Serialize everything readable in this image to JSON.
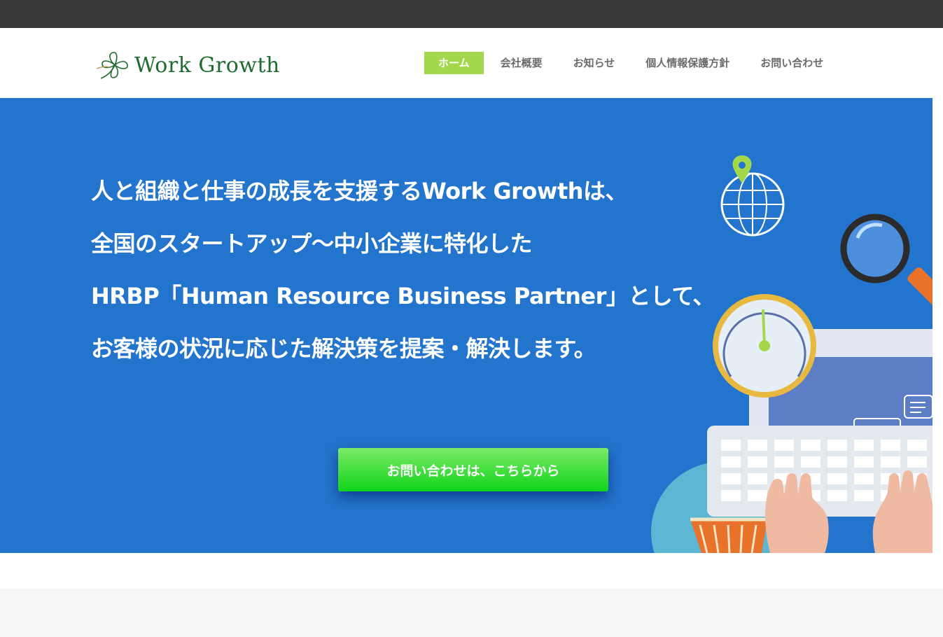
{
  "header": {
    "logo_text": "Work Growth",
    "nav": [
      {
        "label": "ホーム",
        "active": true
      },
      {
        "label": "会社概要",
        "active": false
      },
      {
        "label": "お知らせ",
        "active": false
      },
      {
        "label": "個人情報保護方針",
        "active": false
      },
      {
        "label": "お問い合わせ",
        "active": false
      }
    ]
  },
  "hero": {
    "lines": [
      "人と組織と仕事の成長を支援するWork Growthは、",
      "全国のスタートアップ〜中小企業に特化した",
      "HRBP「Human Resource Business Partner」として、",
      "お客様の状況に応じた解決策を提案・解決します。"
    ],
    "cta_label": "お問い合わせは、こちらから"
  },
  "colors": {
    "topbar": "#373737",
    "hero_bg": "#2374cc",
    "nav_active": "#a3d84c",
    "cta": "#10d41a",
    "logo": "#1f6b2f"
  }
}
